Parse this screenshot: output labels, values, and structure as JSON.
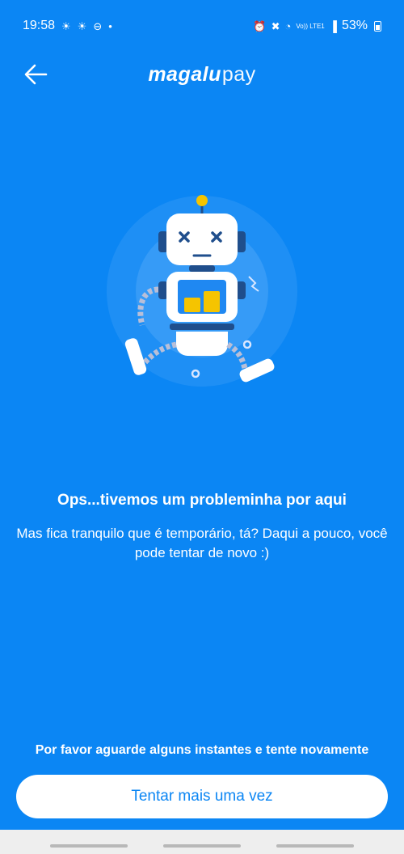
{
  "status_bar": {
    "time": "19:58",
    "network": "Vo)) LTE1",
    "battery": "53%"
  },
  "header": {
    "brand_strong": "magalu",
    "brand_light": "pay"
  },
  "error": {
    "title": "Ops...tivemos um probleminha por aqui",
    "message": "Mas fica tranquilo que é temporário, tá? Daqui a pouco, você pode tentar de novo :)"
  },
  "footer": {
    "wait_text": "Por favor aguarde alguns instantes e tente novamente",
    "retry_label": "Tentar mais uma vez"
  },
  "colors": {
    "background": "#0b86f4",
    "button_text": "#0b86f4",
    "robot_accent": "#f5c400"
  },
  "icons": {
    "back": "arrow-left-icon",
    "illustration": "broken-robot-illustration"
  }
}
